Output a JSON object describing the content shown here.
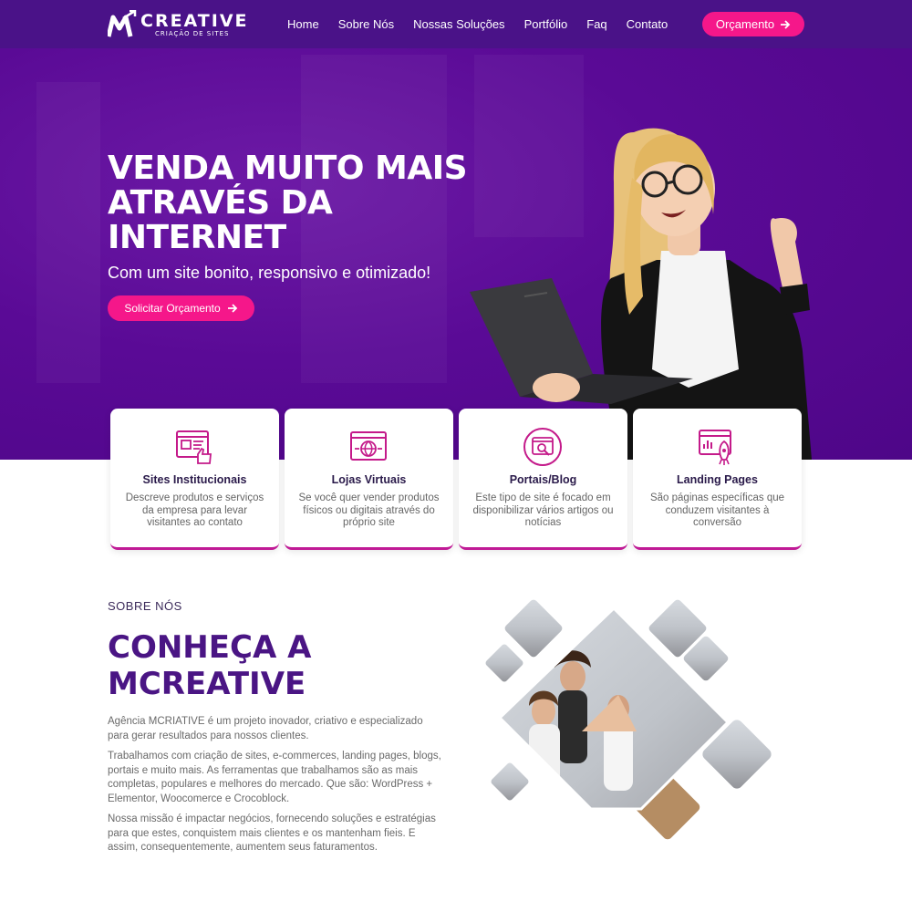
{
  "brand": {
    "name": "CREATIVE",
    "tagline": "CRIAÇÃO DE SITES",
    "primary": "#5a0a96",
    "accent": "#f5178a"
  },
  "nav": [
    {
      "label": "Home"
    },
    {
      "label": "Sobre Nós"
    },
    {
      "label": "Nossas Soluções"
    },
    {
      "label": "Portfólio"
    },
    {
      "label": "Faq"
    },
    {
      "label": "Contato"
    }
  ],
  "header_cta": "Orçamento",
  "hero": {
    "headline_1": "VENDA MUITO MAIS",
    "headline_2": "ATRAVÉS DA",
    "headline_3": "INTERNET",
    "subhead": "Com um site bonito, responsivo e otimizado!",
    "cta": "Solicitar Orçamento"
  },
  "cards": [
    {
      "icon": "website-thumbs-up-icon",
      "title": "Sites Institucionais",
      "text": "Descreve produtos e serviços da empresa para levar visitantes ao contato"
    },
    {
      "icon": "globe-browser-icon",
      "title": "Lojas Virtuais",
      "text": "Se você quer vender produtos físicos ou digitais através do próprio site"
    },
    {
      "icon": "search-browser-icon",
      "title": "Portais/Blog",
      "text": "Este tipo de site é focado em disponibilizar vários artigos ou notícias"
    },
    {
      "icon": "rocket-chart-icon",
      "title": "Landing Pages",
      "text": "São páginas específicas que conduzem visitantes à conversão"
    }
  ],
  "about": {
    "eyebrow": "SOBRE NÓS",
    "title_1": "CONHEÇA A",
    "title_2": "MCREATIVE",
    "p1": "Agência MCRIATIVE é um projeto inovador, criativo e especializado para gerar resultados para nossos clientes.",
    "p2": "Trabalhamos com criação de sites, e-commerces, landing pages, blogs, portais e muito mais. As ferramentas que trabalhamos são as mais completas, populares e melhores do mercado. Que são: WordPress + Elementor, Woocomerce e Crocoblock.",
    "p3": "Nossa missão é impactar negócios, fornecendo soluções e estratégias para que estes, conquistem mais clientes e os mantenham fieis. E assim, consequentemente, aumentem seus faturamentos."
  }
}
